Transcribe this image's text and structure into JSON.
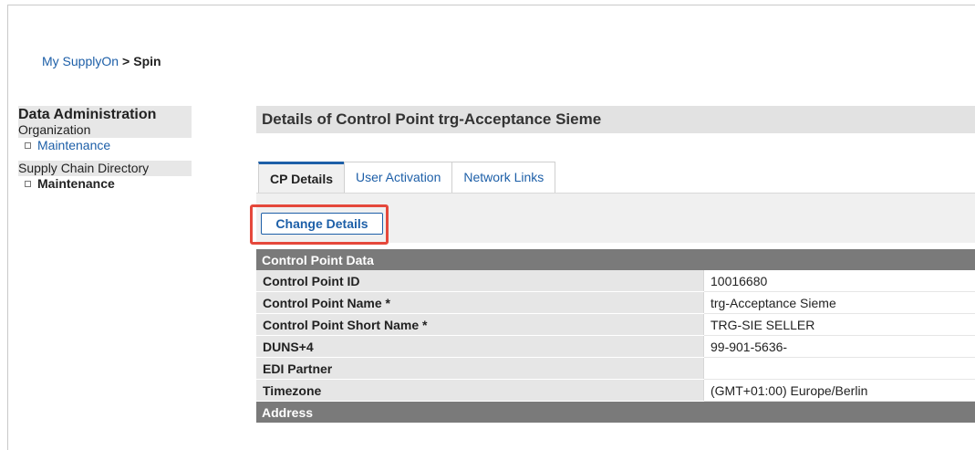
{
  "breadcrumb": {
    "root": "My SupplyOn",
    "separator": ">",
    "current": "Spin"
  },
  "sidebar": {
    "heading": "Data Administration",
    "groups": [
      {
        "title": "Organization",
        "item": "Maintenance"
      },
      {
        "title": "Supply Chain Directory",
        "item": "Maintenance"
      }
    ]
  },
  "page": {
    "title": "Details of Control Point trg-Acceptance Sieme"
  },
  "tabs": [
    {
      "label": "CP Details",
      "active": true
    },
    {
      "label": "User Activation",
      "active": false
    },
    {
      "label": "Network Links",
      "active": false
    }
  ],
  "toolbar": {
    "change_details": "Change Details"
  },
  "sections": {
    "control_point_data": "Control Point Data",
    "address": "Address"
  },
  "rows": [
    {
      "label": "Control Point ID",
      "value": "10016680"
    },
    {
      "label": "Control Point Name *",
      "value": "trg-Acceptance Sieme"
    },
    {
      "label": "Control Point Short Name *",
      "value": "TRG-SIE SELLER"
    },
    {
      "label": "DUNS+4",
      "value": "99-901-5636-"
    },
    {
      "label": "EDI Partner",
      "value": ""
    },
    {
      "label": "Timezone",
      "value": "(GMT+01:00) Europe/Berlin"
    }
  ],
  "colors": {
    "link": "#1d5fa8",
    "highlight": "#e5483b",
    "section_header": "#7a7a7a",
    "label_bg": "#e6e6e6"
  }
}
